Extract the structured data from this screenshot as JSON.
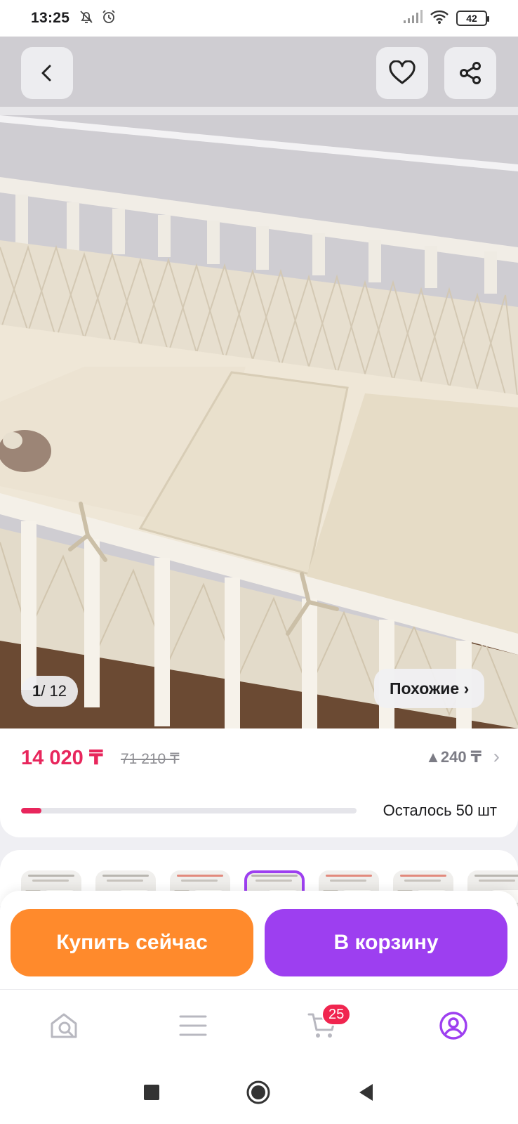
{
  "status_bar": {
    "time": "13:25",
    "battery": "42",
    "icons": [
      "bell-off-icon",
      "alarm-icon",
      "signal-icon",
      "wifi-icon",
      "battery-icon"
    ]
  },
  "gallery": {
    "counter_current": "1",
    "counter_total": "/ 12",
    "similar_label": "Похожие ›"
  },
  "price": {
    "current": "14 020 ₸",
    "old": "71 210 ₸",
    "bonus": "▲240 ₸",
    "stock_text": "Осталось 50 шт",
    "stock_fraction": 0.06,
    "accent_color": "#e8265c"
  },
  "variants": {
    "count_visible": 7,
    "selected_index": 3
  },
  "actions": {
    "buy_now": "Купить сейчас",
    "add_to_cart": "В корзину",
    "buy_color": "#ff8a2c",
    "cart_color": "#9d3ff0"
  },
  "bottom_nav": {
    "items": [
      "home-search-icon",
      "catalog-icon",
      "cart-icon",
      "profile-icon"
    ],
    "cart_badge": "25",
    "active": "profile-icon"
  },
  "system_nav": [
    "recents-square-icon",
    "home-circle-icon",
    "back-triangle-icon"
  ]
}
